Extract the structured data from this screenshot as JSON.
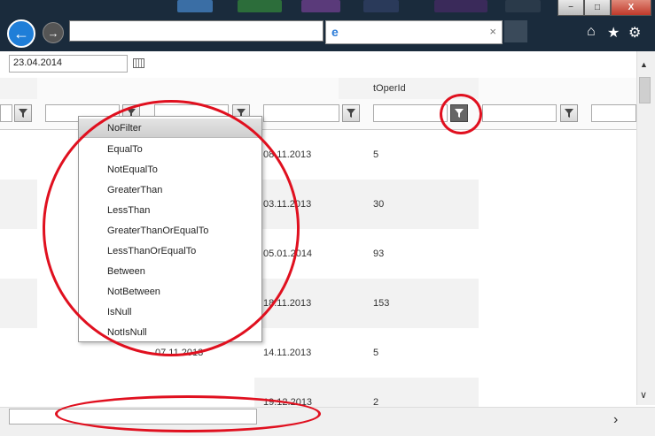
{
  "browser": {
    "back_icon": "←",
    "forward_icon": "→",
    "tab_title": "",
    "tab_close": "×",
    "home_icon": "⌂",
    "favorites_icon": "★",
    "settings_icon": "⚙",
    "window_minimize": "−",
    "window_maximize": "□",
    "window_close": "X"
  },
  "toolbar": {
    "date_value": "23.04.2014",
    "calendar_icon": "calendar-icon"
  },
  "grid": {
    "header_toperid": "tOperId",
    "rows": [
      {
        "date": "08.11.2013",
        "toperid": "5"
      },
      {
        "date": "03.11.2013",
        "toperid": "30"
      },
      {
        "date": "05.01.2014",
        "toperid": "93"
      },
      {
        "date": "18.11.2013",
        "toperid": "153"
      },
      {
        "prev_date": "07.11.2013",
        "date": "14.11.2013",
        "toperid": "5"
      },
      {
        "date": "19.12.2013",
        "toperid": "2"
      }
    ]
  },
  "filter_menu": {
    "options": [
      "NoFilter",
      "EqualTo",
      "NotEqualTo",
      "GreaterThan",
      "LessThan",
      "GreaterThanOrEqualTo",
      "LessThanOrEqualTo",
      "Between",
      "NotBetween",
      "IsNull",
      "NotIsNull"
    ],
    "selected": "NoFilter"
  },
  "scrollbars": {
    "up_arrow": "▲",
    "down_arrow": "∨",
    "right_arrow": "›"
  },
  "colors": {
    "annotation": "#e0101f",
    "accent": "#1f7ed8",
    "titlebar": "#1a2b3c"
  }
}
